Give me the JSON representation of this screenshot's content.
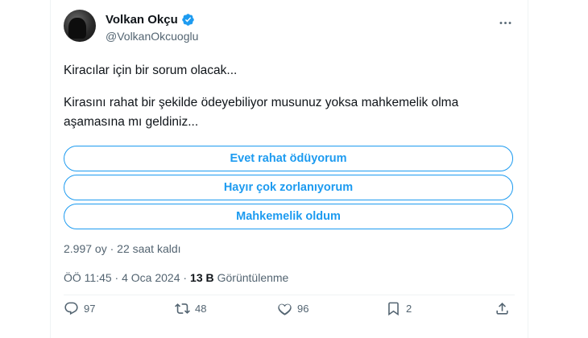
{
  "author": {
    "display_name": "Volkan Okçu",
    "handle": "@VolkanOkcuoglu",
    "verified": true
  },
  "tweet": {
    "paragraphs": [
      "Kiracılar için bir sorum olacak...",
      "Kirasını rahat bir şekilde ödeyebiliyor musunuz yoksa mahkemelik olma aşamasına mı geldiniz..."
    ]
  },
  "poll": {
    "options": [
      "Evet rahat ödüyorum",
      "Hayır çok zorlanıyorum",
      "Mahkemelik oldum"
    ],
    "meta": "2.997 oy · 22 saat kaldı"
  },
  "info": {
    "time_date": "ÖÖ 11:45 · 4 Oca 2024 ·",
    "views_count": "13 B",
    "views_label": "Görüntülenme"
  },
  "actions": {
    "replies": "97",
    "retweets": "48",
    "likes": "96",
    "bookmarks": "2"
  },
  "colors": {
    "accent": "#1d9bf0",
    "text": "#0f1419",
    "secondary": "#536471"
  },
  "icons": [
    "verified-badge-icon",
    "more-options-icon",
    "reply-icon",
    "retweet-icon",
    "like-icon",
    "bookmark-icon",
    "share-icon"
  ]
}
